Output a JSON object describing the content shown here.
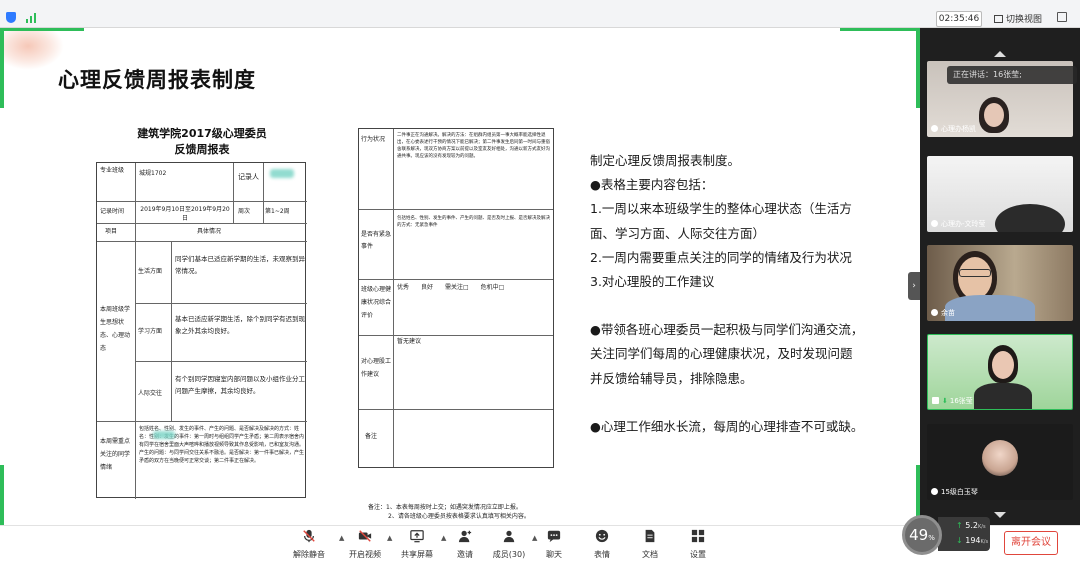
{
  "window": {
    "title": "",
    "time": "02:35:46",
    "switch_view": "切换视图"
  },
  "slide": {
    "title": "心理反馈周报表制度",
    "form1": {
      "title_line1": "建筑学院2017级心理委员",
      "title_line2": "反馈周报表",
      "major_label": "专业班级",
      "major_value": "城规1702",
      "recorder_label": "记录人",
      "record_time_label": "记录时间",
      "record_time_value": "2019年9月10日至2019年9月20日",
      "week_label": "周次",
      "week_value": "第1~2周",
      "item_label": "项目",
      "detail_label": "具体情况",
      "section_label": "本周班级学生思想状态、心理动态",
      "life_label": "生活方面",
      "life_text": "同学们基本已适应新学期的生活，未观察到异常情况。",
      "study_label": "学习方面",
      "study_text": "基本已适应新学期生活，除个别同学有迟到现象之外其余均良好。",
      "social_label": "人际交往",
      "social_text": "有个别同学因寝室内部问题以及小组作业分工问题产生摩擦，其余均良好。",
      "focus_label": "本周需重点关注的同学情绪",
      "focus_text": "包括姓名、性别、发生的事件、产生的问题、是否解决及解决的方式：姓名：性别：发生的事件：第一周时与组组同学产生矛盾；第二周表示宿舍内有同学在宿舍里面大声喧哗和播放视频导致其作息受影响，已和室友沟通。产生的问题：与同学间交往关系不融洽。是否解决：第一件事已解决，产生矛盾的双方在当晚便可正常交谈；第二件事正在解决。"
    },
    "form2": {
      "behavior_label": "行为状况",
      "behavior_text": "二件事正在沟通解决。解决的方法：在组群内组员第一事大概率能选择性退出，在心委表述行干预的情况下能已解决；第二件事发生后同第一时间与重宿舍联系解决，现双方协商方案以前提以及室友友好相处，沟通以新方式友好沟通共事。现应该的没有发现较为的问题。",
      "urgent_label": "是否有紧急事件",
      "urgent_text": "包括姓名、性别、发生的事件、产生的问题、是否及时上报、是否解决及解决的方式：无紧急事件",
      "health_label": "班级心理健康状况综合评价",
      "health_options": "优秀　　良好　　需关注□　　危机中□",
      "advice_label": "对心理股工作建议",
      "advice_text": "暂无建议",
      "remark_label": "备注"
    },
    "footnote_line1": "备注：1、本表每周按时上交；如遇突发情况应立即上报。",
    "footnote_line2": "2、请各班级心理委员按表格要求认真填写相关内容。",
    "description": [
      "制定心理反馈周报表制度。",
      "●表格主要内容包括：",
      "1.一周以来本班级学生的整体心理状态（生活方",
      "面、学习方面、人际交往方面）",
      "2.一周内需要重点关注的同学的情绪及行为状况",
      "3.对心理股的工作建议",
      "",
      "●带领各班心理委员一起积极与同学们沟通交流，",
      "关注同学们每周的心理健康状况，及时发现问题",
      "并反馈给辅导员，排除隐患。",
      "",
      "●心理工作细水长流，每周的心理排查不可或缺。"
    ]
  },
  "panel": {
    "speaking": "正在讲话：16张莹;",
    "participants": [
      {
        "name": "心理办杨凯"
      },
      {
        "name": "心理办-文玲莹"
      },
      {
        "name": "余苗"
      },
      {
        "name": "16张莹"
      },
      {
        "name": "15级白玉琴"
      }
    ]
  },
  "toolbar": {
    "unmute": "解除静音",
    "video": "开启视频",
    "share": "共享屏幕",
    "invite": "邀请",
    "members": "成员(30)",
    "chat": "聊天",
    "emoji": "表情",
    "docs": "文档",
    "settings": "设置",
    "leave": "离开会议"
  },
  "network": {
    "percent": "49",
    "percent_unit": "%",
    "up": "5.2",
    "up_unit": "K/s",
    "down": "194",
    "down_unit": "K/s"
  }
}
